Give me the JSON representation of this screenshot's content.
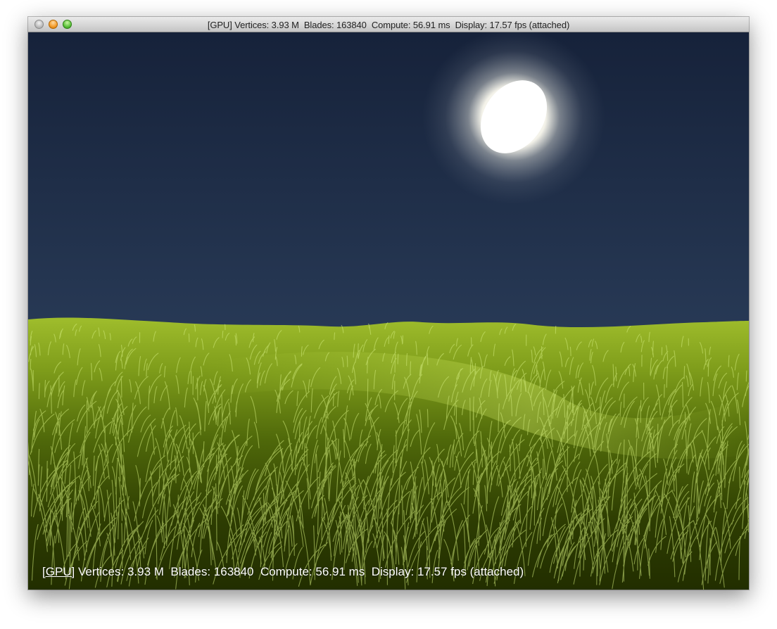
{
  "window": {
    "title": "[GPU] Vertices: 3.93 M  Blades: 163840  Compute: 56.91 ms  Display: 17.57 fps (attached)"
  },
  "overlay": {
    "tag": "[GPU]",
    "stats": " Vertices: 3.93 M  Blades: 163840  Compute: 56.91 ms  Display: 17.57 fps (attached)"
  },
  "colors": {
    "sky_top": "#16223a",
    "sky_horizon": "#5a6470",
    "grass_light": "#c9e86a",
    "grass_dark": "#263300"
  }
}
